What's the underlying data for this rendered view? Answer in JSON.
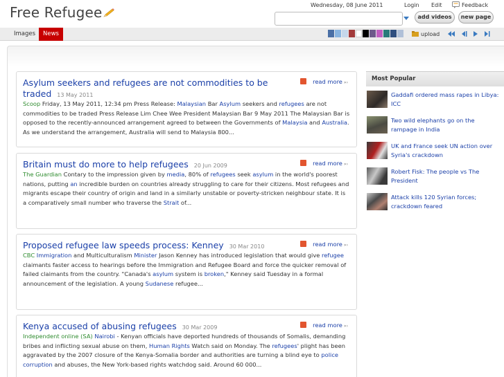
{
  "header": {
    "logo": "Free Refugee",
    "date": "Wednesday, 08 June 2011",
    "login": "Login",
    "edit": "Edit",
    "feedback": "Feedback",
    "search_value": "",
    "add_videos": "add videos",
    "new_page": "new page"
  },
  "nav": {
    "tabs": [
      {
        "label": "Images",
        "active": false
      },
      {
        "label": "News",
        "active": true
      }
    ],
    "swatches": [
      "#4a6fa5",
      "#89b4e0",
      "#c5d7ea",
      "#a33b3b",
      "#ffffff",
      "#000000",
      "#6d5a8a",
      "#c060c0",
      "#2a7a7a",
      "#2f4f7f",
      "#b0c0d8"
    ],
    "upload": "upload"
  },
  "articles": [
    {
      "title": "Asylum seekers and refugees are not commodities to be traded",
      "date": "13 May 2011",
      "source": "Scoop",
      "readmore": "read more",
      "text": [
        {
          "t": "  Friday, 13 May 2011, 12:34 pm Press Release: "
        },
        {
          "t": "Malaysian",
          "link": true
        },
        {
          "t": " Bar "
        },
        {
          "t": "Asylum",
          "link": true
        },
        {
          "t": " seekers and "
        },
        {
          "t": "refugees",
          "link": true
        },
        {
          "t": " are not commodities to be traded Press Release Lim Chee Wee President Malaysian Bar 9 May 2011 The Malaysian Bar is opposed to the recently-announced arrangement agreed to between the Governments of "
        },
        {
          "t": "Malaysia",
          "link": true
        },
        {
          "t": " and "
        },
        {
          "t": "Australia",
          "link": true
        },
        {
          "t": ". As we understand the arrangement, Australia will send to Malaysia 800..."
        }
      ]
    },
    {
      "title": "Britain must do more to help refugees",
      "date": "20 Jun 2009",
      "source": "The Guardian",
      "readmore": "read more",
      "text": [
        {
          "t": "  Contary to the impression given by "
        },
        {
          "t": "media",
          "link": true
        },
        {
          "t": ", 80% of "
        },
        {
          "t": "refugees",
          "link": true
        },
        {
          "t": " seek "
        },
        {
          "t": "asylum",
          "link": true
        },
        {
          "t": " in the world's poorest nations, putting "
        },
        {
          "t": "an",
          "link": true
        },
        {
          "t": " incredible burden on countries already struggling to care for their citizens. Most refugees and migrants escape their country of origin and land in a similarly unstable or poverty-stricken neighbour state. It is a comparatively small number who traverse the "
        },
        {
          "t": "Strait",
          "link": true
        },
        {
          "t": " of..."
        }
      ]
    },
    {
      "title": "Proposed refugee law speeds process: Kenney",
      "date": "30 Mar 2010",
      "source": "CBC",
      "readmore": "read more",
      "text": [
        {
          "t": "  "
        },
        {
          "t": "Immigration",
          "link": true
        },
        {
          "t": " and Multiculturalism "
        },
        {
          "t": "Minister",
          "link": true
        },
        {
          "t": " Jason Kenney has introduced legislation that would give "
        },
        {
          "t": "refugee",
          "link": true
        },
        {
          "t": " claimants faster access to hearings before the Immigration and Refugee Board and force the quicker removal of failed claimants from the country. \"Canada's "
        },
        {
          "t": "asylum",
          "link": true
        },
        {
          "t": " system is "
        },
        {
          "t": "broken",
          "link": true
        },
        {
          "t": ",\" Kenney said Tuesday in a formal announcement of the legislation. A young "
        },
        {
          "t": "Sudanese",
          "link": true
        },
        {
          "t": " refugee..."
        }
      ]
    },
    {
      "title": " Kenya accused of abusing refugees",
      "date": "30 Mar 2009",
      "source": "Independent online (SA)",
      "readmore": "read more",
      "text": [
        {
          "t": "  "
        },
        {
          "t": "Nairobi",
          "link": true
        },
        {
          "t": " - Kenyan officials have deported hundreds of thousands of Somalis, demanding bribes and inflicting sexual abuse on them, "
        },
        {
          "t": "Human Rights",
          "link": true
        },
        {
          "t": " Watch said on Monday. The "
        },
        {
          "t": "refugees",
          "link": true
        },
        {
          "t": "' plight has been aggravated by the 2007 closure of the Kenya-Somalia border and authorities are turning a blind eye to "
        },
        {
          "t": "police",
          "link": true
        },
        {
          "t": " "
        },
        {
          "t": "corruption",
          "link": true
        },
        {
          "t": " and abuses, the New York-based rights watchdog said. Around 60 000..."
        }
      ]
    }
  ],
  "sidebar": {
    "heading": "Most Popular",
    "items": [
      {
        "text": "Gaddafi ordered mass rapes in Libya: ICC"
      },
      {
        "text": "Two wild elephants go on the rampage in India"
      },
      {
        "text": "UK and France seek UN action over Syria's crackdown"
      },
      {
        "text": "Robert Fisk: The people vs The President"
      },
      {
        "text": "Attack kills 120 Syrian forces; crackdown feared"
      }
    ]
  }
}
